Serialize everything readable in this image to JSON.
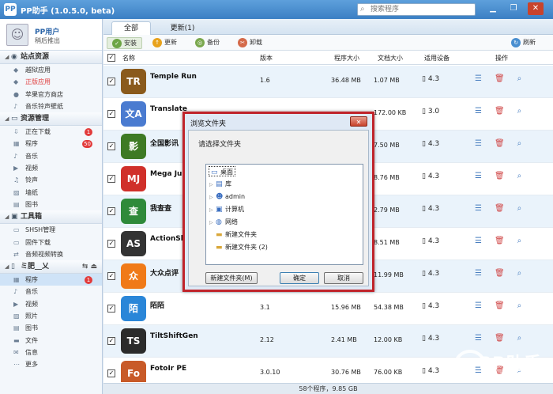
{
  "app": {
    "title": "PP助手 (1.0.5.0, beta)",
    "logo": "PP"
  },
  "search": {
    "placeholder": "搜索程序"
  },
  "window_controls": [
    "minimize-icon",
    "restore-icon",
    "close-icon"
  ],
  "user": {
    "name": "PP用户",
    "action": "稍后推出"
  },
  "sidebar": {
    "sections": [
      {
        "label": "站点资源",
        "icon": "globe-icon",
        "items": [
          {
            "label": "越狱应用",
            "icon": "cube-icon"
          },
          {
            "label": "正版应用",
            "icon": "cube-icon",
            "highlight": true
          },
          {
            "label": "苹果官方商店",
            "icon": "apple-icon"
          },
          {
            "label": "音乐铃声壁纸",
            "icon": "music-icon"
          }
        ]
      },
      {
        "label": "资源管理",
        "icon": "monitor-icon",
        "items": [
          {
            "label": "正在下载",
            "icon": "download-icon",
            "badge": "1"
          },
          {
            "label": "程序",
            "icon": "grid-icon",
            "badge": "50"
          },
          {
            "label": "音乐",
            "icon": "music-icon"
          },
          {
            "label": "视频",
            "icon": "video-icon"
          },
          {
            "label": "铃声",
            "icon": "bell-icon"
          },
          {
            "label": "墙纸",
            "icon": "image-icon"
          },
          {
            "label": "图书",
            "icon": "book-icon"
          }
        ]
      },
      {
        "label": "工具箱",
        "icon": "toolbox-icon",
        "items": [
          {
            "label": "SHSH管理",
            "icon": "doc-icon"
          },
          {
            "label": "固件下载",
            "icon": "doc-icon"
          },
          {
            "label": "音频视频转换",
            "icon": "convert-icon"
          }
        ]
      },
      {
        "label": "ミ肥__乂",
        "icon": "phone-icon",
        "device": true,
        "items": [
          {
            "label": "程序",
            "icon": "grid-icon",
            "badge": "1",
            "selected": true
          },
          {
            "label": "音乐",
            "icon": "music-icon"
          },
          {
            "label": "视频",
            "icon": "video-icon"
          },
          {
            "label": "照片",
            "icon": "image-icon"
          },
          {
            "label": "图书",
            "icon": "book-icon"
          },
          {
            "label": "文件",
            "icon": "folder-icon"
          },
          {
            "label": "信息",
            "icon": "message-icon"
          },
          {
            "label": "更多",
            "icon": "more-icon"
          }
        ]
      }
    ]
  },
  "tabs": [
    {
      "label": "全部",
      "active": true
    },
    {
      "label": "更新(1)",
      "active": false
    }
  ],
  "toolbar": {
    "install": "安装",
    "update": "更新",
    "backup": "备份",
    "uninstall": "卸载",
    "refresh": "刷新"
  },
  "columns": {
    "name": "名称",
    "version": "版本",
    "app_size": "程序大小",
    "doc_size": "文档大小",
    "device": "适用设备",
    "ops": "操作"
  },
  "apps": [
    {
      "name": "Temple Run",
      "version": "1.6",
      "app_size": "36.48 MB",
      "doc_size": "1.07 MB",
      "device": "4.3",
      "color": "#8a5a1c",
      "glyph": "TR"
    },
    {
      "name": "Translate",
      "version": "",
      "app_size": "",
      "doc_size": "172.00 KB",
      "device": "3.0",
      "color": "#4a7bd0",
      "glyph": "文A"
    },
    {
      "name": "全国影讯",
      "version": "",
      "app_size": "",
      "doc_size": "7.50 MB",
      "device": "4.3",
      "color": "#3e7a24",
      "glyph": "影"
    },
    {
      "name": "Mega Jump",
      "version": "",
      "app_size": "",
      "doc_size": "8.76 MB",
      "device": "4.3",
      "color": "#d0302a",
      "glyph": "MJ"
    },
    {
      "name": "我查查",
      "version": "",
      "app_size": "",
      "doc_size": "2.79 MB",
      "device": "4.3",
      "color": "#2f8a3a",
      "glyph": "查"
    },
    {
      "name": "ActionShot",
      "version": "",
      "app_size": "",
      "doc_size": "8.51 MB",
      "device": "4.3",
      "color": "#333333",
      "glyph": "AS"
    },
    {
      "name": "大众点评",
      "version": "",
      "app_size": "",
      "doc_size": "11.99 MB",
      "device": "4.3",
      "color": "#f07a18",
      "glyph": "众"
    },
    {
      "name": "陌陌",
      "version": "3.1",
      "app_size": "15.96 MB",
      "doc_size": "54.38 MB",
      "device": "4.3",
      "color": "#2a86d8",
      "glyph": "陌"
    },
    {
      "name": "TiltShiftGen",
      "version": "2.12",
      "app_size": "2.41 MB",
      "doc_size": "12.00 KB",
      "device": "4.3",
      "color": "#2b2b2b",
      "glyph": "TS"
    },
    {
      "name": "FotoIr PE",
      "version": "3.0.10",
      "app_size": "30.76 MB",
      "doc_size": "76.00 KB",
      "device": "4.3",
      "color": "#c85a28",
      "glyph": "Fo"
    }
  ],
  "status": "58个程序，9.85 GB",
  "dialog": {
    "title": "浏览文件夹",
    "close": "✕",
    "prompt": "请选择文件夹",
    "tree": [
      {
        "label": "桌面",
        "icon": "desktop-icon",
        "level": 0,
        "expand": false,
        "selected": true
      },
      {
        "label": "库",
        "icon": "library-icon",
        "level": 1,
        "expand": true
      },
      {
        "label": "admin",
        "icon": "user-folder-icon",
        "level": 1,
        "expand": true
      },
      {
        "label": "计算机",
        "icon": "computer-icon",
        "level": 1,
        "expand": true
      },
      {
        "label": "网络",
        "icon": "network-icon",
        "level": 1,
        "expand": true
      },
      {
        "label": "新建文件夹",
        "icon": "folder-icon",
        "level": 1,
        "expand": false
      },
      {
        "label": "新建文件夹 (2)",
        "icon": "folder-icon",
        "level": 1,
        "expand": false
      }
    ],
    "new_folder": "新建文件夹(M)",
    "ok": "确定",
    "cancel": "取消"
  },
  "watermark": {
    "brand": "PP助手",
    "url": "pp.25pp.com"
  }
}
